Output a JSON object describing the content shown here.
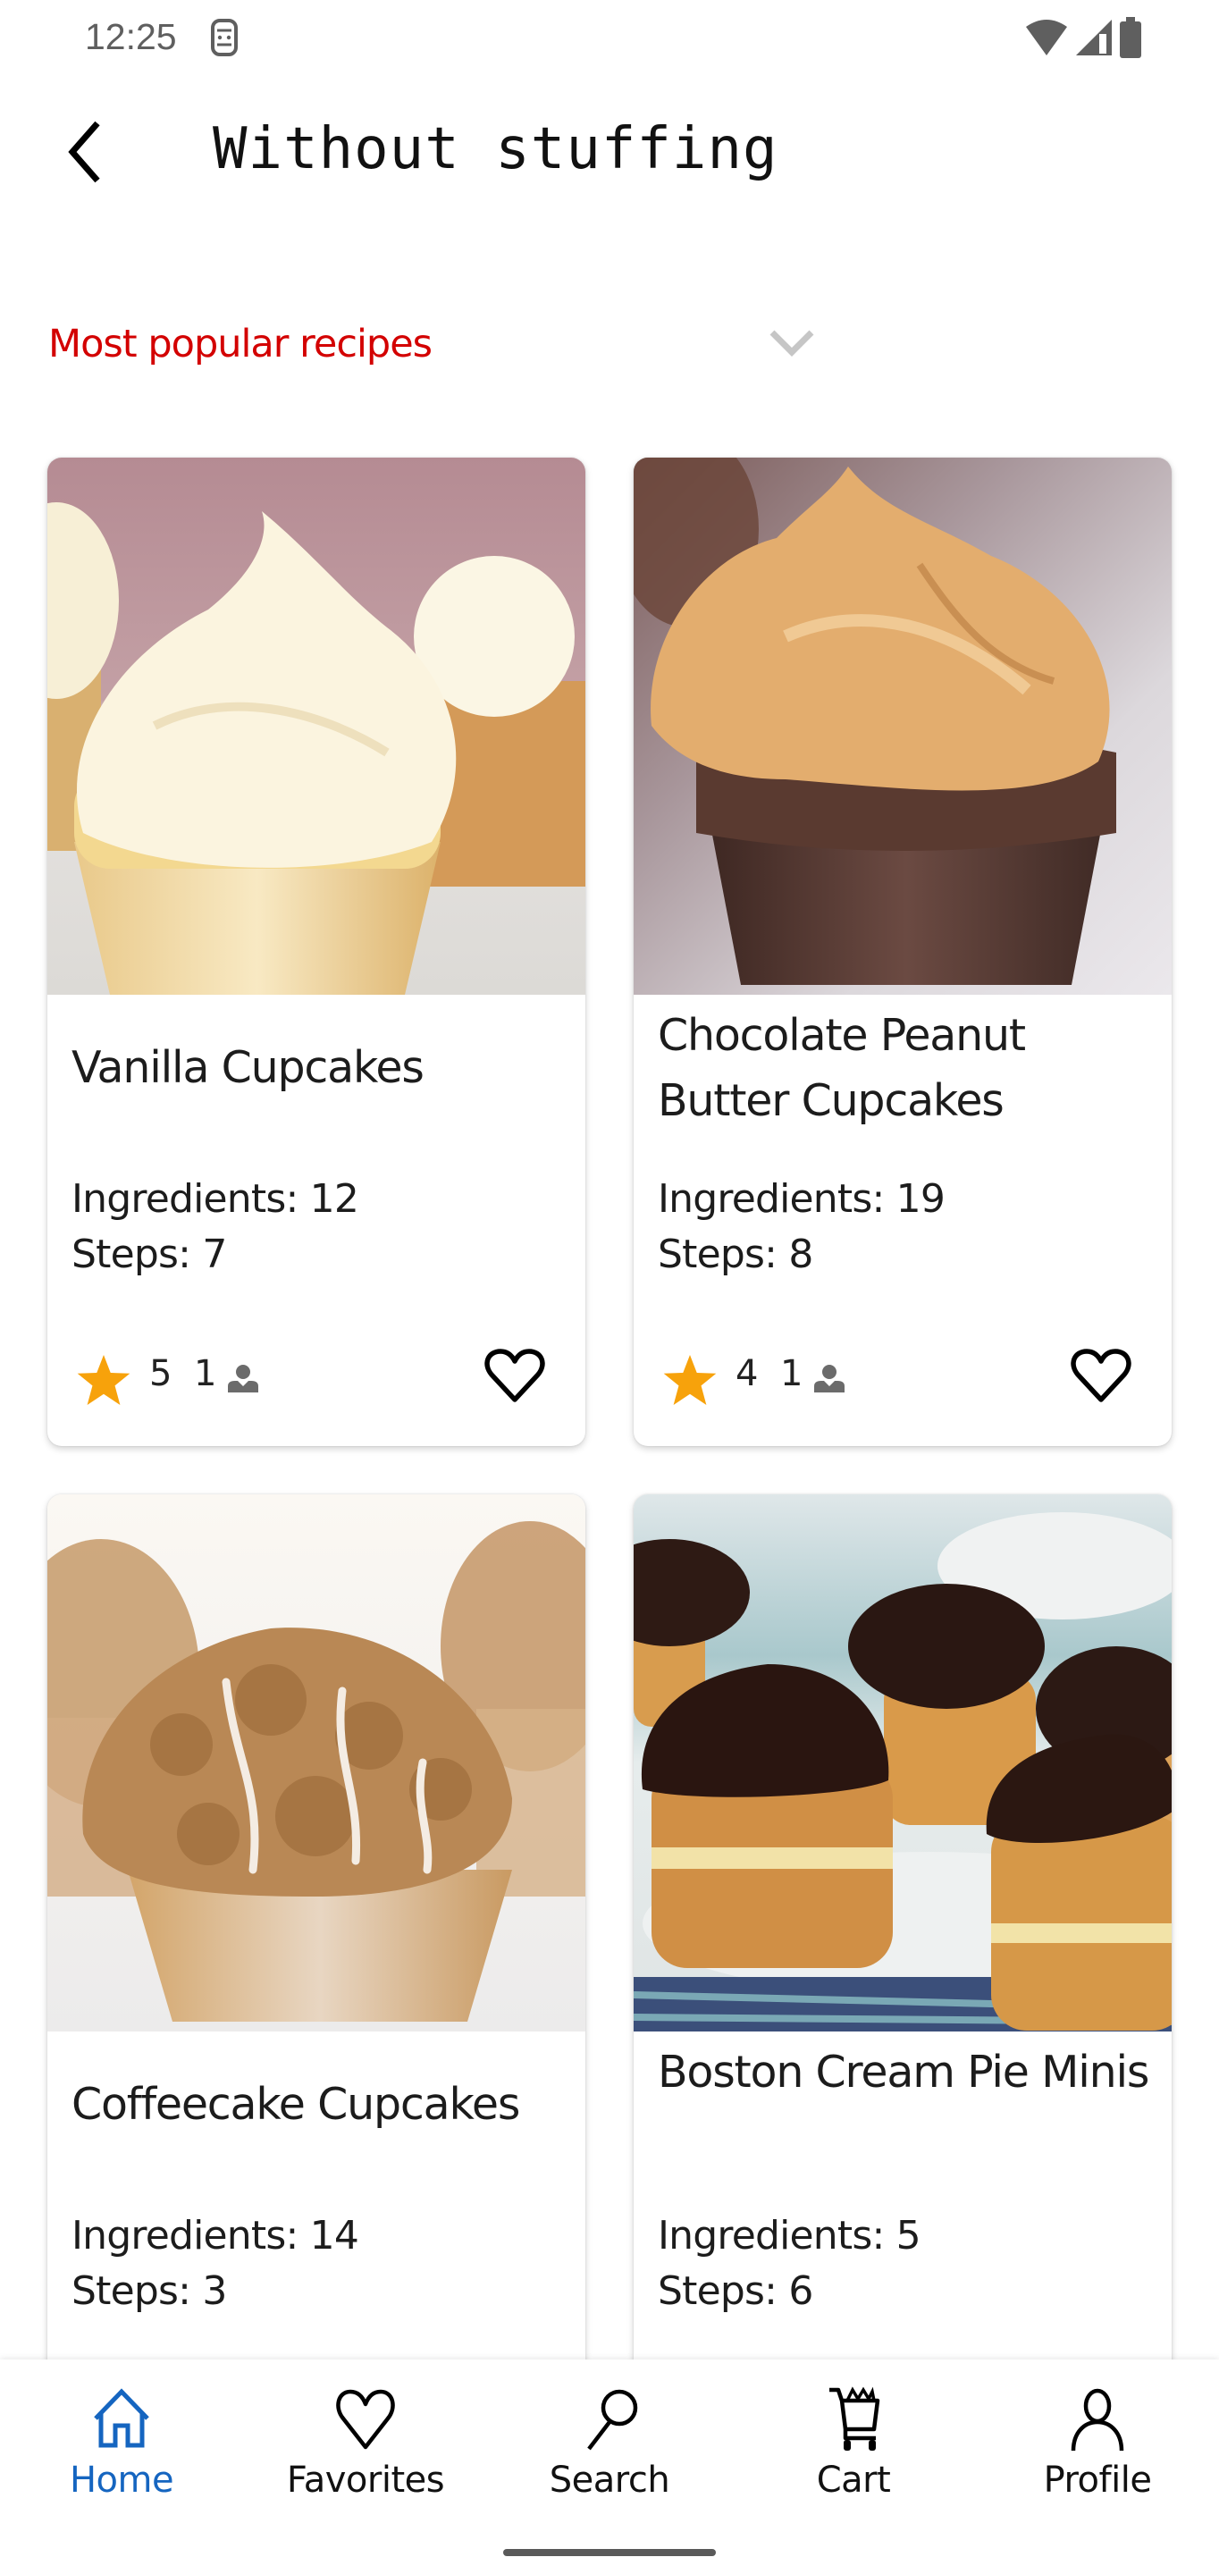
{
  "status_bar": {
    "time": "12:25",
    "icons": [
      "notification-sim-icon",
      "wifi-icon",
      "cellular-signal-icon",
      "battery-icon"
    ]
  },
  "app_bar": {
    "back_icon": "chevron-left-icon",
    "title": "Without stuffing"
  },
  "sort": {
    "selected": "Most popular recipes",
    "icon": "chevron-down-icon",
    "accent_color": "#d30000"
  },
  "recipes": [
    {
      "title": "Vanilla Cupcakes",
      "ingredients": "Ingredients: 12",
      "steps": "Steps: 7",
      "rating": "5",
      "reviews": "1",
      "favorite": false,
      "image": "vanilla cupcakes with white buttercream swirl"
    },
    {
      "title": "Chocolate Peanut Butter Cupcakes",
      "ingredients": "Ingredients: 19",
      "steps": "Steps: 8",
      "rating": "4",
      "reviews": "1",
      "favorite": false,
      "image": "chocolate cupcake with peanut butter frosting"
    },
    {
      "title": "Coffeecake Cupcakes",
      "ingredients": "Ingredients: 14",
      "steps": "Steps: 3",
      "image": "coffeecake cupcake with crumb topping and glaze"
    },
    {
      "title": "Boston Cream Pie Minis",
      "ingredients": "Ingredients: 5",
      "steps": "Steps: 6",
      "image": "mini cakes with chocolate ganache and cream filling"
    }
  ],
  "colors": {
    "star": "#f7a20b",
    "nav_active": "#1565c0",
    "person_icon": "#6b6b6b"
  },
  "bottom_nav": {
    "active": "Home",
    "items": [
      {
        "label": "Home",
        "icon": "home-icon"
      },
      {
        "label": "Favorites",
        "icon": "heart-icon"
      },
      {
        "label": "Search",
        "icon": "search-icon"
      },
      {
        "label": "Cart",
        "icon": "cart-icon"
      },
      {
        "label": "Profile",
        "icon": "person-icon"
      }
    ]
  }
}
